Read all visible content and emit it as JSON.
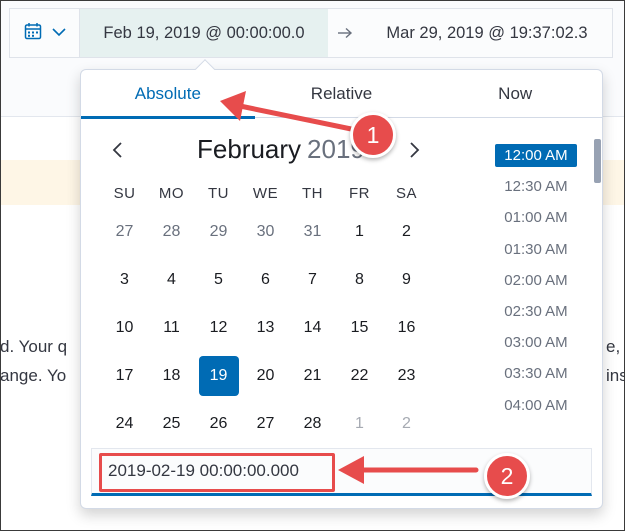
{
  "picker": {
    "start": "Feb 19, 2019 @ 00:00:00.0",
    "end": "Mar 29, 2019 @ 19:37:02.3"
  },
  "popover": {
    "tabs": [
      "Absolute",
      "Relative",
      "Now"
    ],
    "active_tab": "Absolute",
    "month": "February",
    "year": "2019",
    "weekdays": [
      "SU",
      "MO",
      "TU",
      "WE",
      "TH",
      "FR",
      "SA"
    ],
    "weeks": [
      [
        "27",
        "28",
        "29",
        "30",
        "31",
        "1",
        "2"
      ],
      [
        "3",
        "4",
        "5",
        "6",
        "7",
        "8",
        "9"
      ],
      [
        "10",
        "11",
        "12",
        "13",
        "14",
        "15",
        "16"
      ],
      [
        "17",
        "18",
        "19",
        "20",
        "21",
        "22",
        "23"
      ],
      [
        "24",
        "25",
        "26",
        "27",
        "28",
        "1",
        "2"
      ]
    ],
    "selected_day": "19",
    "times": [
      "12:00 AM",
      "12:30 AM",
      "01:00 AM",
      "01:30 AM",
      "02:00 AM",
      "02:30 AM",
      "03:00 AM",
      "03:30 AM",
      "04:00 AM"
    ],
    "selected_time": "12:00 AM",
    "input_value": "2019-02-19 00:00:00.000"
  },
  "background": {
    "line1_left": "d. Your q",
    "line1_right": "e,",
    "line2_left": "ange. Yo",
    "line2_right": "ins"
  },
  "annotations": {
    "badge1": "1",
    "badge2": "2",
    "color": "#e74c4c"
  },
  "colors": {
    "accent": "#006bb4",
    "range_start_bg": "#e6f1f0"
  }
}
